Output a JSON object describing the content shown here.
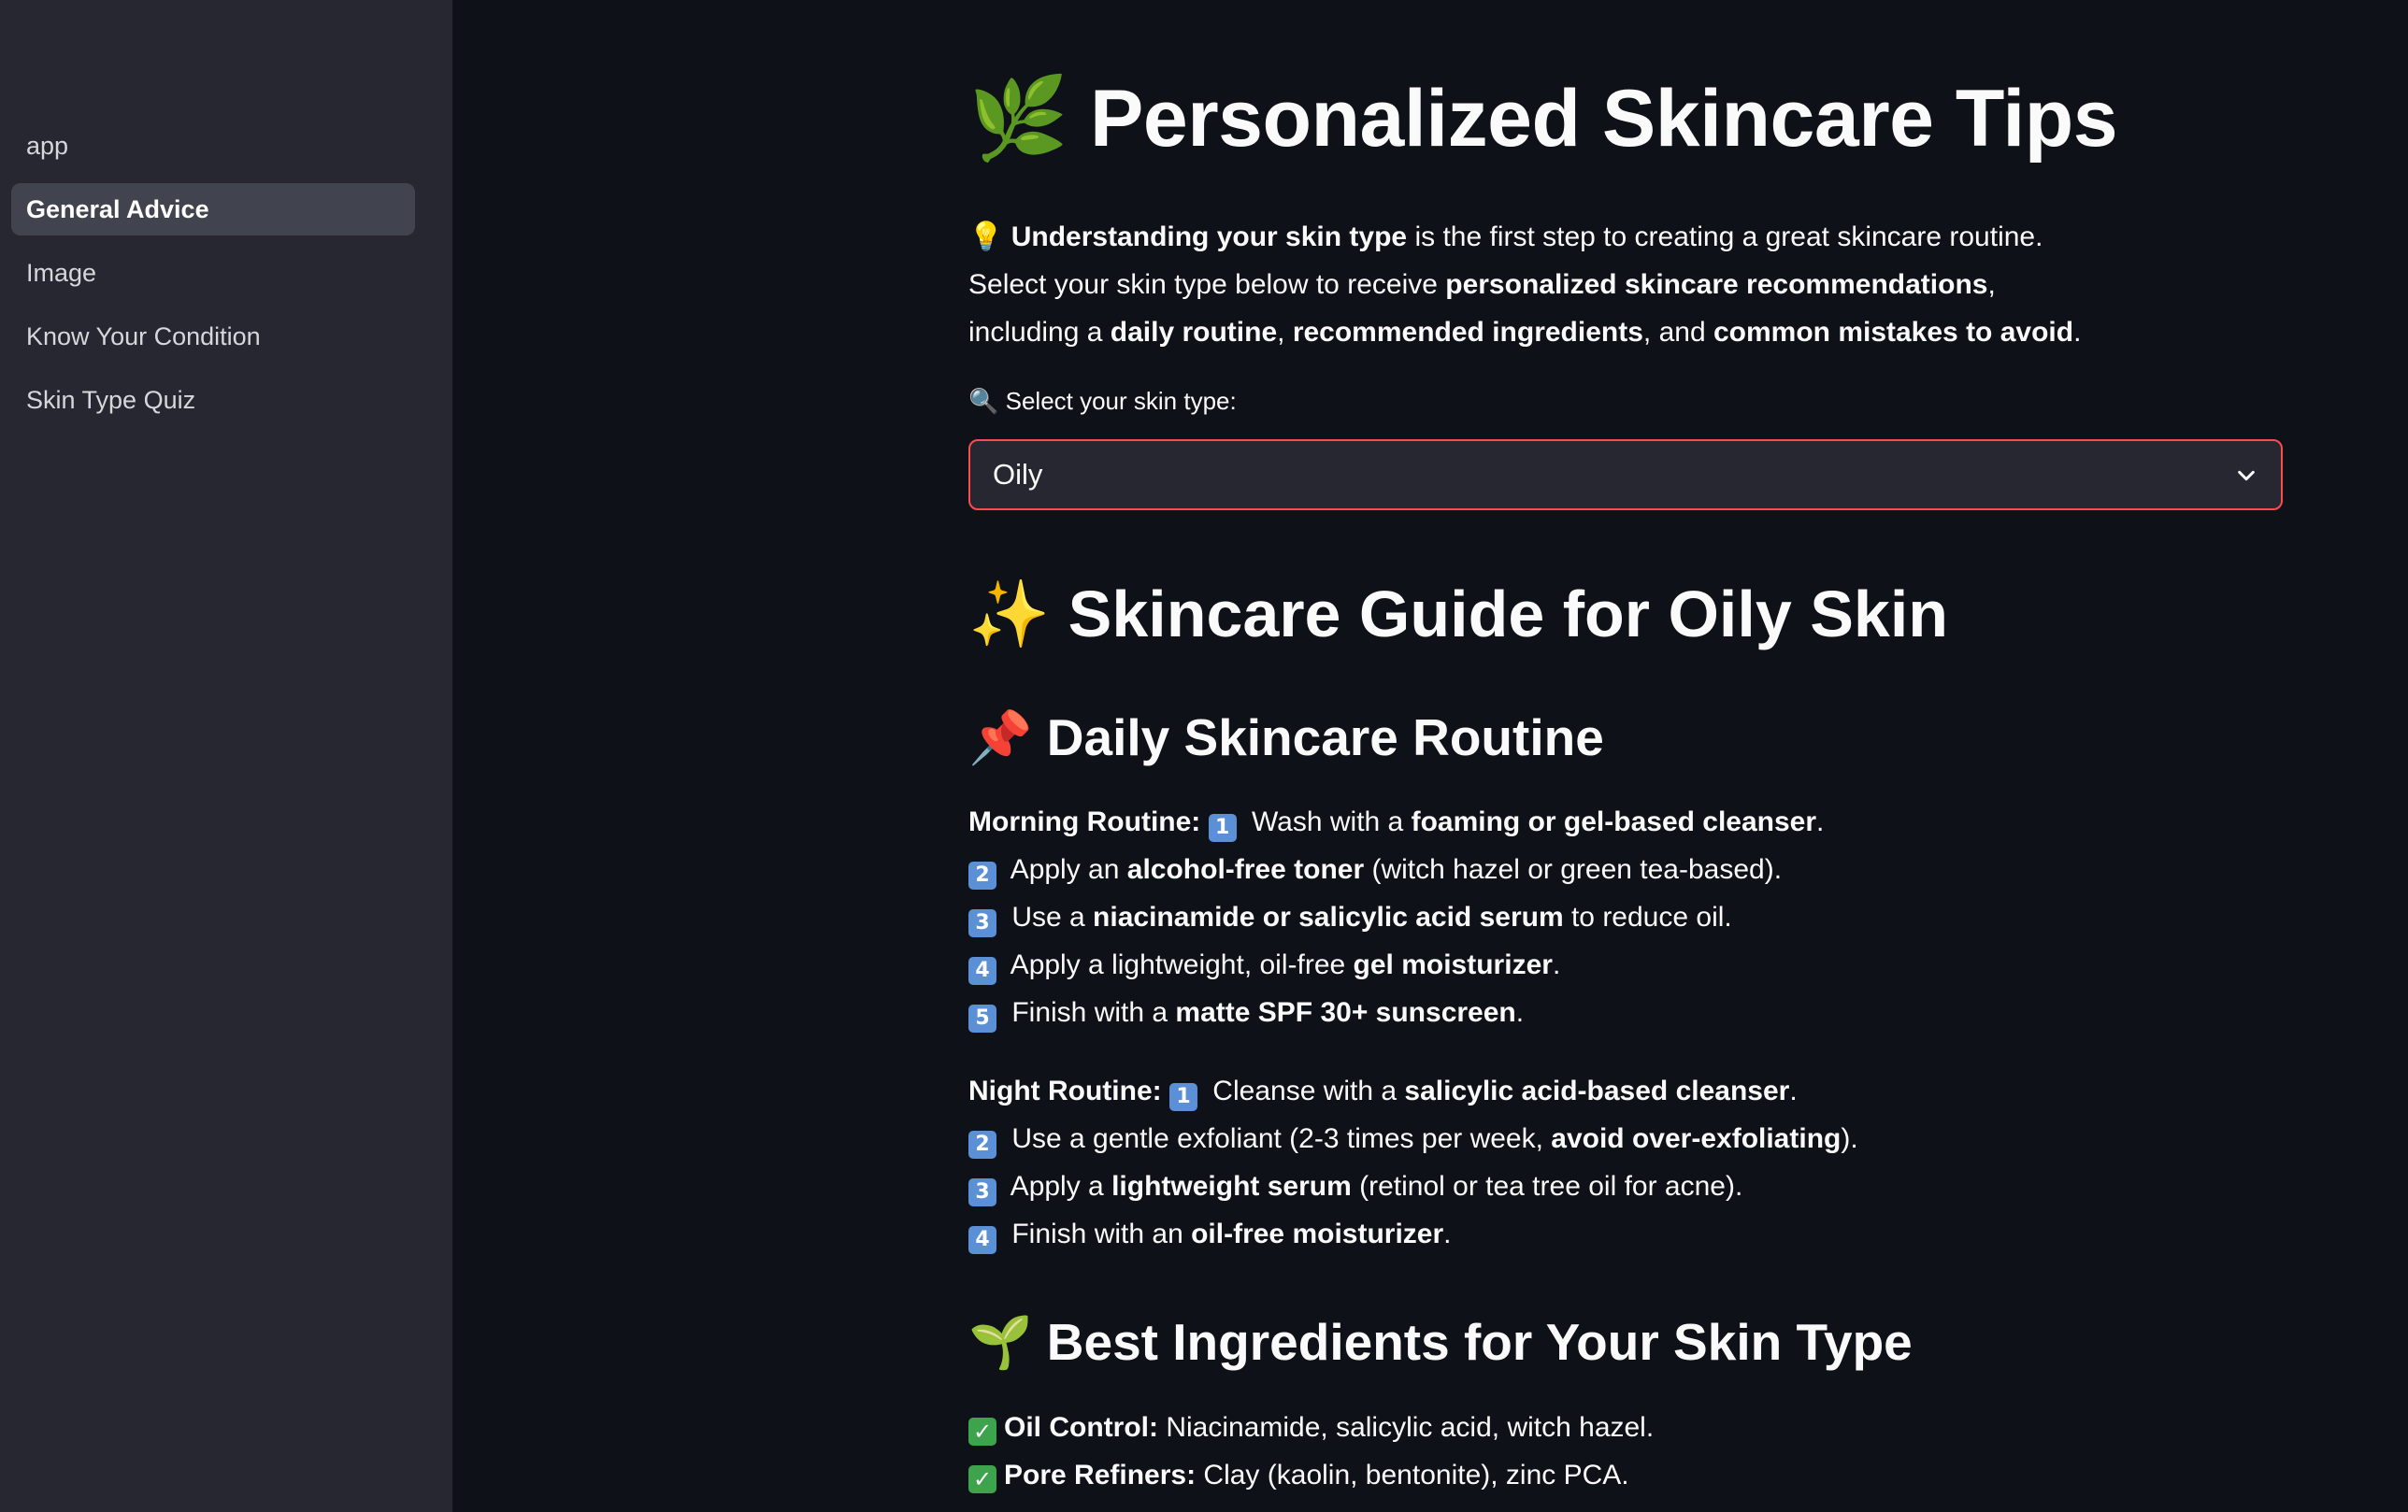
{
  "sidebar": {
    "items": [
      {
        "label": "app"
      },
      {
        "label": "General Advice",
        "active": true
      },
      {
        "label": "Image"
      },
      {
        "label": "Know Your Condition"
      },
      {
        "label": "Skin Type Quiz"
      }
    ]
  },
  "page": {
    "title_icon": "🌿",
    "title": "Personalized Skincare Tips"
  },
  "intro": {
    "icon": "💡",
    "l1_b1": "Understanding your skin type",
    "l1_t1": " is the first step to creating a great skincare routine.",
    "l2_t1": "Select your skin type below to receive ",
    "l2_b1": "personalized skincare recommendations",
    "l2_t2": ",",
    "l3_t1": "including a ",
    "l3_b1": "daily routine",
    "l3_t2": ", ",
    "l3_b2": "recommended ingredients",
    "l3_t3": ", and ",
    "l3_b3": "common mistakes to avoid",
    "l3_t4": "."
  },
  "select": {
    "icon": "🔍",
    "label": "Select your skin type:",
    "value": "Oily"
  },
  "guide": {
    "icon": "✨",
    "title": "Skincare Guide for Oily Skin"
  },
  "routine": {
    "icon": "📌",
    "heading": "Daily Skincare Routine",
    "morning": {
      "label": "Morning Routine:",
      "steps": [
        {
          "n": "1",
          "t1": " Wash with a ",
          "b": "foaming or gel-based cleanser",
          "t2": "."
        },
        {
          "n": "2",
          "t1": " Apply an ",
          "b": "alcohol-free toner",
          "t2": " (witch hazel or green tea-based)."
        },
        {
          "n": "3",
          "t1": " Use a ",
          "b": "niacinamide or salicylic acid serum",
          "t2": " to reduce oil."
        },
        {
          "n": "4",
          "t1": " Apply a lightweight, oil-free ",
          "b": "gel moisturizer",
          "t2": "."
        },
        {
          "n": "5",
          "t1": " Finish with a ",
          "b": "matte SPF 30+ sunscreen",
          "t2": "."
        }
      ]
    },
    "night": {
      "label": "Night Routine:",
      "steps": [
        {
          "n": "1",
          "t1": " Cleanse with a ",
          "b": "salicylic acid-based cleanser",
          "t2": "."
        },
        {
          "n": "2",
          "t1": " Use a gentle exfoliant (2-3 times per week, ",
          "b": "avoid over-exfoliating",
          "t2": ")."
        },
        {
          "n": "3",
          "t1": " Apply a ",
          "b": "lightweight serum",
          "t2": " (retinol or tea tree oil for acne)."
        },
        {
          "n": "4",
          "t1": " Finish with an ",
          "b": "oil-free moisturizer",
          "t2": "."
        }
      ]
    }
  },
  "ingredients": {
    "icon": "🌱",
    "heading": "Best Ingredients for Your Skin Type",
    "items": [
      {
        "b": "Oil Control:",
        "t": " Niacinamide, salicylic acid, witch hazel."
      },
      {
        "b": "Pore Refiners:",
        "t": " Clay (kaolin, bentonite), zinc PCA."
      }
    ]
  },
  "colors": {
    "background": "#0e1117",
    "sidebar": "#262730",
    "accent": "#ff4b4b",
    "keycap": "#5b8fd6",
    "check": "#3ea34d"
  }
}
